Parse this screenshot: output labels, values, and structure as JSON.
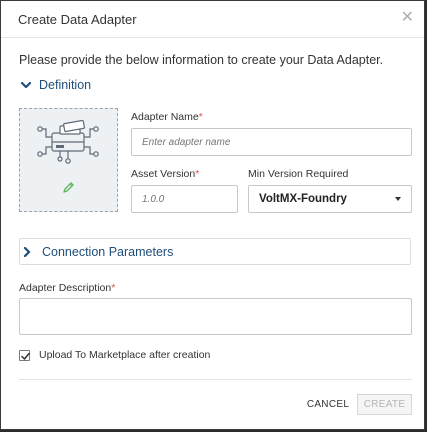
{
  "dialog": {
    "title": "Create Data Adapter",
    "close_icon": "close-icon"
  },
  "intro_text": "Please provide the below information to create your Data Adapter.",
  "definition_section": {
    "label": "Definition",
    "expanded": true,
    "icon_name": "adapter-icon",
    "edit_icon": "pencil-icon"
  },
  "adapter_name": {
    "label": "Adapter Name",
    "required_mark": "*",
    "placeholder": "Enter adapter name",
    "value": ""
  },
  "asset_version": {
    "label": "Asset Version",
    "required_mark": "*",
    "placeholder": "1.0.0",
    "value": ""
  },
  "min_version": {
    "label": "Min Version Required",
    "selected": "VoltMX-Foundry"
  },
  "connection_section": {
    "label": "Connection Parameters",
    "expanded": false
  },
  "description": {
    "label": "Adapter Description",
    "required_mark": "*",
    "value": ""
  },
  "upload_option": {
    "label": "Upload To Marketplace after creation",
    "checked": true
  },
  "buttons": {
    "cancel": "CANCEL",
    "create": "CREATE"
  },
  "colors": {
    "accent": "#1f4e79",
    "required": "#d9534f",
    "icon_green": "#5cb85c"
  }
}
